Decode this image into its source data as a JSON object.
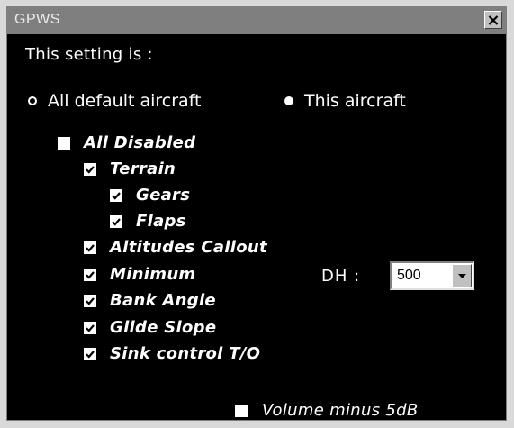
{
  "window": {
    "title": "GPWS",
    "close_icon": "close-x-icon"
  },
  "setting_scope": {
    "label": "This setting is :",
    "options": [
      {
        "label": "All default aircraft",
        "selected": false
      },
      {
        "label": "This aircraft",
        "selected": true
      }
    ]
  },
  "options": {
    "all_disabled": {
      "label": "All Disabled",
      "checked": false
    },
    "terrain": {
      "label": "Terrain",
      "checked": true
    },
    "gears": {
      "label": "Gears",
      "checked": true
    },
    "flaps": {
      "label": "Flaps",
      "checked": true
    },
    "altitudes_callout": {
      "label": "Altitudes Callout",
      "checked": true
    },
    "minimum": {
      "label": "Minimum",
      "checked": true
    },
    "bank_angle": {
      "label": "Bank Angle",
      "checked": true
    },
    "glide_slope": {
      "label": "Glide Slope",
      "checked": true
    },
    "sink_control": {
      "label": "Sink control T/O",
      "checked": true
    },
    "volume_minus": {
      "label": "Volume minus 5dB",
      "checked": false
    }
  },
  "dh": {
    "label": "DH :",
    "value": "500",
    "arrow_icon": "dropdown-arrow-icon"
  },
  "colors": {
    "background": "#000000",
    "titlebar": "#7f7f7f",
    "text": "#ffffff"
  }
}
